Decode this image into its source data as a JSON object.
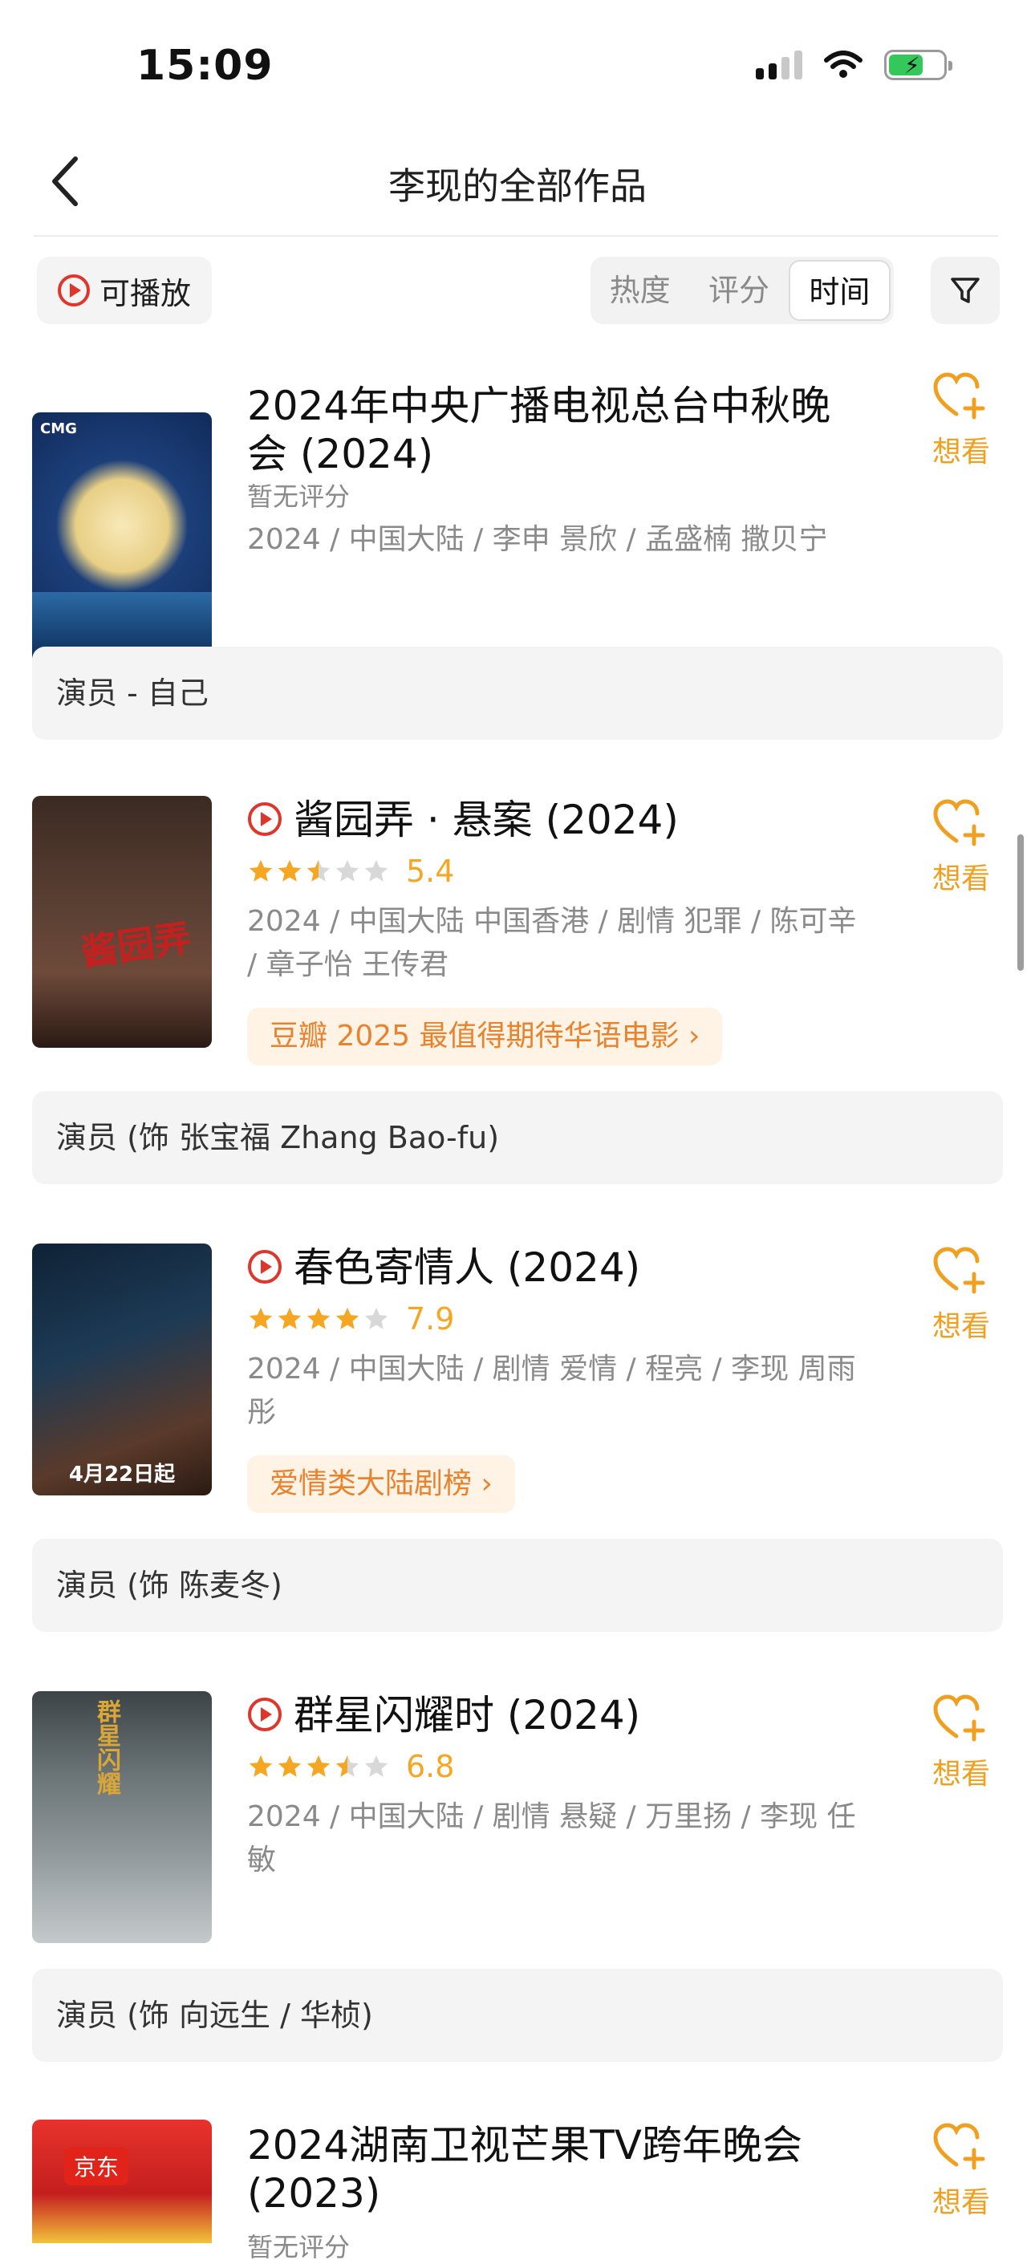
{
  "status": {
    "time": "15:09"
  },
  "nav": {
    "title": "李现的全部作品"
  },
  "filters": {
    "playable_label": "可播放",
    "sort_options": [
      "热度",
      "评分",
      "时间"
    ],
    "active_sort": "时间"
  },
  "want_label": "想看",
  "works": [
    {
      "title": "2024年中央广播电视总台中秋晚会 (2024)",
      "playable": false,
      "rating_text": "暂无评分",
      "meta": "2024 / 中国大陆 / 李申 景欣 / 孟盛楠 撒贝宁",
      "role": "演员 - 自己",
      "poster_theme": "moon"
    },
    {
      "title": "酱园弄 · 悬案 (2024)",
      "playable": true,
      "stars": 2.5,
      "score": "5.4",
      "meta": "2024 / 中国大陆 中国香港 / 剧情 犯罪 / 陈可辛 / 章子怡 王传君",
      "tag": "豆瓣 2025 最值得期待华语电影 ›",
      "role": "演员 (饰 张宝福 Zhang Bao-fu)",
      "poster_theme": "dark-red"
    },
    {
      "title": "春色寄情人 (2024)",
      "playable": true,
      "stars": 4,
      "score": "7.9",
      "meta": "2024 / 中国大陆 / 剧情 爱情 / 程亮 / 李现 周雨彤",
      "tag": "爱情类大陆剧榜 ›",
      "role": "演员 (饰 陈麦冬)",
      "poster_theme": "night-blue",
      "poster_caption": "4月22日起"
    },
    {
      "title": "群星闪耀时 (2024)",
      "playable": true,
      "stars": 3.5,
      "score": "6.8",
      "meta": "2024 / 中国大陆 / 剧情 悬疑 / 万里扬 / 李现 任敏",
      "role": "演员 (饰 向远生 / 华桢)",
      "poster_theme": "gray-fog"
    },
    {
      "title": "2024湖南卫视芒果TV跨年晚会 (2023)",
      "playable": false,
      "rating_text": "暂无评分",
      "poster_theme": "red-party",
      "poster_caption": "京东"
    }
  ],
  "colors": {
    "accent_orange": "#f0a020",
    "play_red": "#e0352b",
    "star_gold": "#f5a623"
  }
}
